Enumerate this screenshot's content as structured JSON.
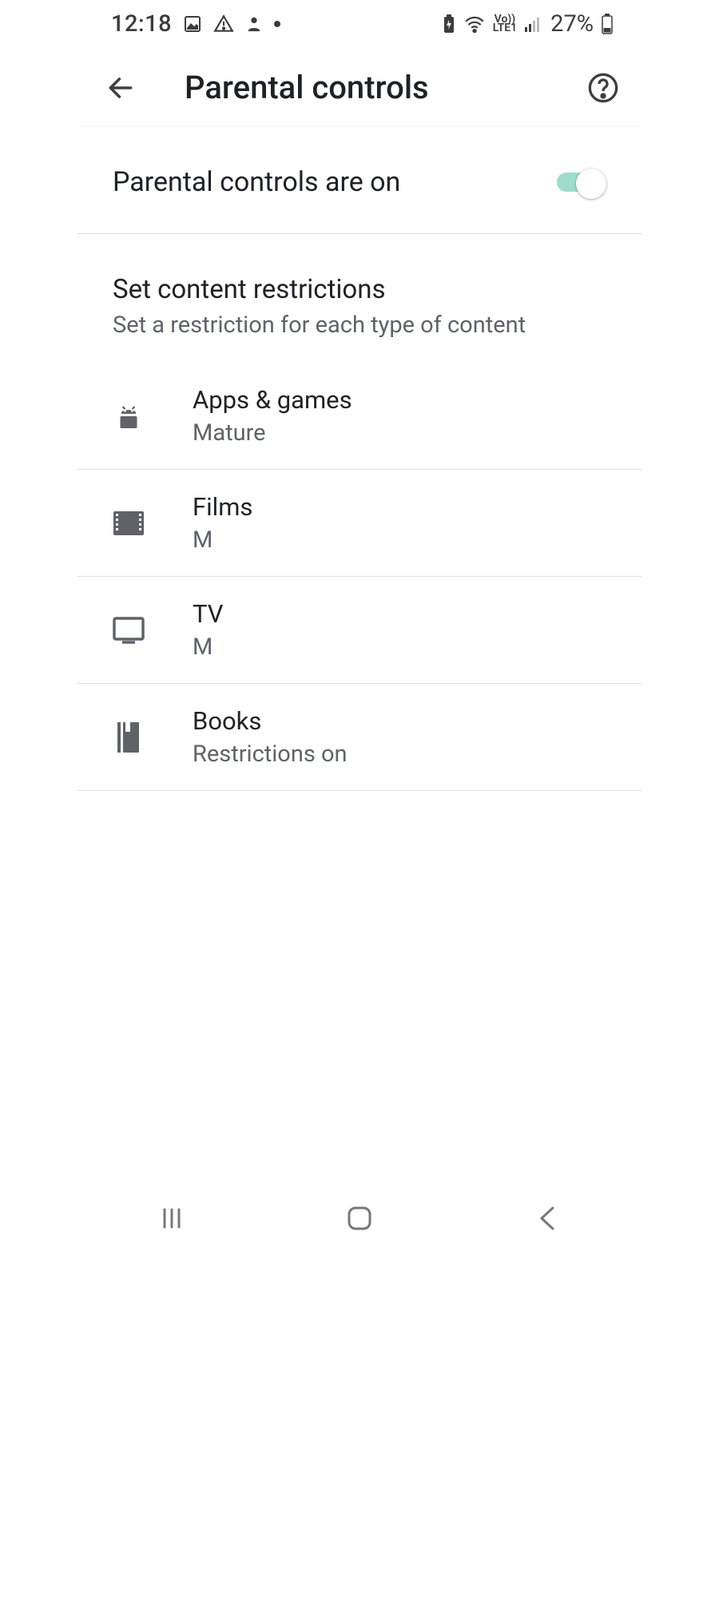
{
  "status": {
    "time": "12:18",
    "battery_pct": "27%",
    "lte_top": "Vo))",
    "lte_bottom": "LTE1"
  },
  "header": {
    "title": "Parental controls"
  },
  "toggle": {
    "label": "Parental controls are on",
    "state": "on"
  },
  "section": {
    "title": "Set content restrictions",
    "subtitle": "Set a restriction for each type of content"
  },
  "items": [
    {
      "title": "Apps & games",
      "subtitle": "Mature",
      "icon": "android-icon"
    },
    {
      "title": "Films",
      "subtitle": "M",
      "icon": "film-icon"
    },
    {
      "title": "TV",
      "subtitle": "M",
      "icon": "tv-icon"
    },
    {
      "title": "Books",
      "subtitle": "Restrictions on",
      "icon": "book-icon"
    }
  ]
}
